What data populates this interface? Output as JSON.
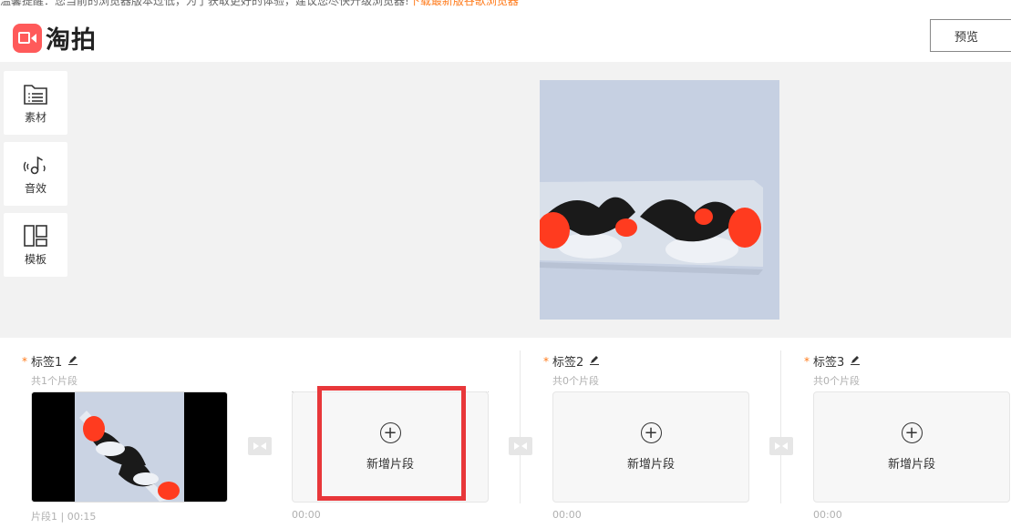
{
  "notice": {
    "text": "温馨提醒：您当前的浏览器版本过低，为了获取更好的体验，建议您尽快升级浏览器!",
    "link": "下载最新版谷歌浏览器"
  },
  "header": {
    "brand": "淘拍",
    "preview_label": "预览"
  },
  "tools": [
    {
      "label": "素材",
      "icon": "folder-list-icon"
    },
    {
      "label": "音效",
      "icon": "music-note-icon"
    },
    {
      "label": "模板",
      "icon": "template-layout-icon"
    }
  ],
  "groups": [
    {
      "title": "标签1",
      "count": "共1个片段",
      "clip_label": "片段1 | 00:15"
    },
    {
      "add_label": "新增片段",
      "time": "00:00"
    },
    {
      "title": "标签2",
      "count": "共0个片段",
      "add_label": "新增片段",
      "time": "00:00"
    },
    {
      "title": "标签3",
      "count": "共0个片段",
      "add_label": "新增片段",
      "time": "00:00"
    }
  ],
  "colors": {
    "accent_orange": "#ff7a1a",
    "highlight_red": "#e8373a",
    "brand_red": "#ff5a5a"
  }
}
